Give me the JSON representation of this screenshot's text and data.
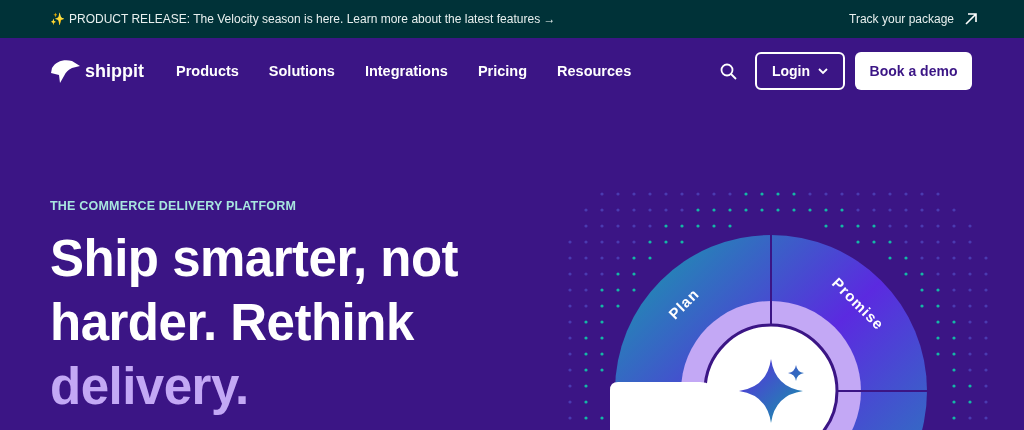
{
  "announcement": {
    "icon": "✨",
    "text": "PRODUCT RELEASE: The Velocity season is here. Learn more about the latest features →",
    "link": "Track your package"
  },
  "nav": {
    "logo": "shippit",
    "items": [
      "Products",
      "Solutions",
      "Integrations",
      "Pricing",
      "Resources"
    ],
    "login": "Login",
    "cta": "Book a demo"
  },
  "hero": {
    "eyebrow": "THE COMMERCE DELIVERY PLATFORM",
    "headline": "Ship smarter, not harder. Rethink",
    "headline_highlight": "delivery.",
    "wheel_segments": [
      "Plan",
      "Promise"
    ]
  }
}
